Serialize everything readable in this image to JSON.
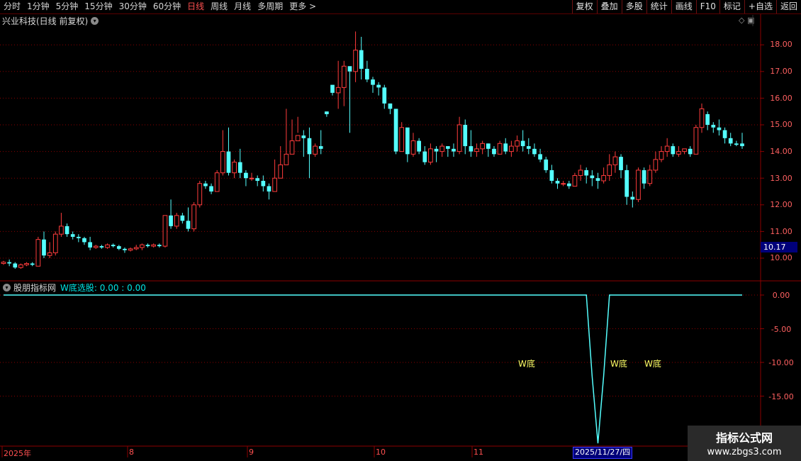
{
  "toolbar": {
    "periods": [
      "分时",
      "1分钟",
      "5分钟",
      "15分钟",
      "30分钟",
      "60分钟",
      "日线",
      "周线",
      "月线",
      "多周期",
      "更多 >"
    ],
    "active_period": "日线",
    "buttons": [
      "复权",
      "叠加",
      "多股",
      "统计",
      "画线",
      "F10",
      "标记",
      "+自选",
      "返回"
    ]
  },
  "main_chart": {
    "title": "兴业科技(日线 前复权)",
    "y_ticks": [
      "18.00",
      "17.00",
      "16.00",
      "15.00",
      "14.00",
      "13.00",
      "12.00",
      "11.00",
      "10.00"
    ],
    "current_price": "10.17",
    "colors": {
      "up": "#ff3c3c",
      "down": "#54ffff",
      "grid": "#8b0000",
      "axis": "#8b0000"
    }
  },
  "indicator": {
    "name": "股朋指标网",
    "label": "W底选股: 0.00 : 0.00",
    "y_ticks": [
      "0.00",
      "-5.00",
      "-10.00",
      "-15.00"
    ],
    "w_labels": [
      "W底",
      "W底",
      "W底"
    ],
    "line_color": "#54ffff"
  },
  "x_axis": {
    "labels": [
      "2025年",
      "8",
      "9",
      "10",
      "11"
    ],
    "cursor_date": "2025/11/27/四"
  },
  "watermark": {
    "line1": "指标公式网",
    "line2": "www.zbgs3.com"
  },
  "chart_data": {
    "type": "candlestick",
    "title": "兴业科技(日线 前复权)",
    "y_ticks": [
      10,
      11,
      12,
      13,
      14,
      15,
      16,
      17,
      18
    ],
    "candles": [
      [
        9.8,
        9.85,
        9.75,
        9.9
      ],
      [
        9.85,
        9.8,
        9.7,
        9.95
      ],
      [
        9.8,
        9.65,
        9.6,
        9.85
      ],
      [
        9.65,
        9.75,
        9.6,
        9.8
      ],
      [
        9.75,
        9.8,
        9.7,
        9.85
      ],
      [
        9.8,
        9.75,
        9.7,
        9.85
      ],
      [
        9.7,
        10.7,
        9.7,
        10.8
      ],
      [
        10.7,
        10.1,
        10.0,
        11.0
      ],
      [
        10.1,
        10.2,
        10.0,
        10.6
      ],
      [
        10.2,
        10.9,
        10.1,
        11.0
      ],
      [
        10.9,
        11.2,
        10.8,
        11.7
      ],
      [
        11.2,
        10.9,
        10.8,
        11.3
      ],
      [
        10.9,
        10.8,
        10.7,
        11.0
      ],
      [
        10.8,
        10.75,
        10.6,
        10.9
      ],
      [
        10.75,
        10.6,
        10.5,
        10.8
      ],
      [
        10.6,
        10.4,
        10.3,
        10.8
      ],
      [
        10.4,
        10.45,
        10.35,
        10.5
      ],
      [
        10.45,
        10.4,
        10.35,
        10.5
      ],
      [
        10.4,
        10.5,
        10.35,
        10.55
      ],
      [
        10.5,
        10.45,
        10.4,
        10.55
      ],
      [
        10.45,
        10.35,
        10.3,
        10.5
      ],
      [
        10.35,
        10.3,
        10.2,
        10.4
      ],
      [
        10.3,
        10.35,
        10.25,
        10.4
      ],
      [
        10.35,
        10.4,
        10.3,
        10.5
      ],
      [
        10.4,
        10.5,
        10.3,
        10.55
      ],
      [
        10.5,
        10.45,
        10.4,
        10.55
      ],
      [
        10.45,
        10.5,
        10.4,
        10.55
      ],
      [
        10.5,
        10.45,
        10.4,
        10.55
      ],
      [
        10.45,
        11.6,
        10.4,
        11.6
      ],
      [
        11.6,
        11.2,
        11.1,
        12.2
      ],
      [
        11.2,
        11.6,
        11.1,
        11.7
      ],
      [
        11.6,
        11.4,
        11.3,
        11.7
      ],
      [
        11.4,
        11.1,
        11.0,
        11.9
      ],
      [
        11.1,
        12.0,
        11.0,
        12.1
      ],
      [
        12.0,
        12.8,
        11.9,
        12.9
      ],
      [
        12.8,
        12.7,
        12.6,
        12.9
      ],
      [
        12.7,
        12.5,
        12.4,
        12.8
      ],
      [
        12.5,
        13.2,
        12.5,
        13.3
      ],
      [
        13.2,
        14.0,
        13.1,
        14.8
      ],
      [
        14.0,
        13.2,
        13.1,
        14.9
      ],
      [
        13.2,
        13.6,
        13.0,
        13.7
      ],
      [
        13.6,
        13.2,
        13.0,
        14.1
      ],
      [
        13.2,
        13.0,
        12.7,
        13.3
      ],
      [
        13.0,
        13.0,
        12.9,
        13.2
      ],
      [
        13.0,
        12.9,
        12.7,
        13.1
      ],
      [
        12.9,
        12.7,
        12.5,
        13.1
      ],
      [
        12.7,
        12.5,
        12.2,
        12.8
      ],
      [
        12.5,
        13.0,
        12.5,
        13.7
      ],
      [
        13.0,
        13.5,
        13.2,
        14.2
      ],
      [
        13.5,
        13.9,
        13.6,
        15.6
      ],
      [
        13.9,
        14.4,
        14.1,
        15.2
      ],
      [
        14.4,
        14.6,
        14.7,
        15.3
      ],
      [
        14.6,
        14.5,
        13.8,
        14.8
      ],
      [
        14.5,
        13.9,
        13.0,
        14.9
      ],
      [
        13.9,
        14.2,
        13.8,
        14.3
      ],
      [
        14.2,
        14.1,
        13.9,
        14.8
      ],
      [
        15.5,
        15.4,
        15.3,
        15.5
      ],
      [
        16.5,
        16.2,
        16.1,
        16.3
      ],
      [
        16.2,
        16.4,
        15.6,
        17.4
      ],
      [
        16.4,
        17.2,
        15.7,
        17.4
      ],
      [
        17.2,
        17.0,
        14.7,
        17.0
      ],
      [
        17.0,
        17.8,
        16.6,
        18.5
      ],
      [
        17.8,
        17.1,
        16.7,
        18.3
      ],
      [
        17.1,
        16.7,
        16.6,
        17.4
      ],
      [
        16.7,
        16.5,
        16.2,
        16.8
      ],
      [
        16.5,
        16.4,
        16.1,
        16.6
      ],
      [
        16.4,
        15.8,
        15.6,
        16.5
      ],
      [
        15.8,
        15.6,
        15.4,
        15.8
      ],
      [
        15.6,
        14.0,
        13.9,
        15.3
      ],
      [
        14.0,
        14.9,
        14.8,
        15.1
      ],
      [
        14.9,
        13.9,
        13.6,
        14.4
      ],
      [
        13.9,
        14.4,
        13.8,
        14.7
      ],
      [
        14.4,
        14.0,
        13.9,
        14.5
      ],
      [
        14.0,
        13.6,
        13.5,
        14.2
      ],
      [
        13.6,
        14.1,
        13.5,
        14.3
      ],
      [
        14.1,
        14.0,
        13.6,
        14.2
      ],
      [
        14.0,
        14.2,
        13.8,
        14.3
      ],
      [
        14.2,
        14.1,
        13.8,
        14.2
      ],
      [
        14.1,
        14.0,
        13.8,
        14.3
      ],
      [
        14.0,
        15.0,
        13.9,
        15.3
      ],
      [
        15.0,
        14.2,
        13.9,
        15.2
      ],
      [
        14.2,
        14.0,
        13.8,
        14.8
      ],
      [
        14.0,
        14.1,
        13.8,
        14.3
      ],
      [
        14.1,
        14.3,
        13.9,
        14.4
      ],
      [
        14.3,
        14.1,
        13.8,
        14.3
      ],
      [
        14.1,
        13.9,
        13.8,
        14.2
      ],
      [
        13.9,
        14.3,
        13.9,
        14.4
      ],
      [
        14.3,
        14.0,
        13.9,
        14.5
      ],
      [
        14.0,
        14.2,
        13.8,
        14.4
      ],
      [
        14.2,
        14.4,
        14.0,
        14.6
      ],
      [
        14.4,
        14.2,
        14.0,
        14.8
      ],
      [
        14.2,
        14.1,
        13.9,
        14.5
      ],
      [
        14.1,
        13.9,
        13.8,
        14.3
      ],
      [
        13.9,
        13.7,
        13.6,
        14.1
      ],
      [
        13.7,
        13.3,
        13.2,
        13.8
      ],
      [
        13.3,
        12.9,
        12.8,
        13.5
      ],
      [
        12.9,
        12.8,
        12.6,
        13.0
      ],
      [
        12.8,
        12.8,
        12.7,
        12.9
      ],
      [
        12.8,
        12.7,
        12.6,
        12.9
      ],
      [
        12.7,
        13.1,
        12.7,
        13.2
      ],
      [
        13.1,
        13.3,
        12.9,
        13.5
      ],
      [
        13.3,
        13.1,
        12.8,
        13.4
      ],
      [
        13.1,
        13.0,
        12.7,
        13.3
      ],
      [
        13.0,
        12.9,
        12.6,
        13.2
      ],
      [
        12.9,
        13.1,
        12.8,
        13.4
      ],
      [
        13.1,
        13.5,
        12.9,
        13.9
      ],
      [
        13.5,
        13.8,
        13.2,
        14.0
      ],
      [
        13.8,
        13.3,
        13.0,
        13.9
      ],
      [
        13.3,
        12.3,
        12.0,
        13.5
      ],
      [
        12.3,
        12.2,
        11.9,
        12.5
      ],
      [
        12.2,
        13.3,
        12.1,
        13.4
      ],
      [
        13.3,
        12.8,
        12.6,
        13.4
      ],
      [
        12.8,
        13.3,
        12.7,
        13.5
      ],
      [
        13.3,
        13.7,
        13.2,
        14.0
      ],
      [
        13.7,
        14.0,
        13.6,
        14.2
      ],
      [
        14.0,
        14.2,
        13.8,
        14.5
      ],
      [
        14.2,
        13.9,
        13.8,
        14.3
      ],
      [
        13.9,
        14.0,
        13.8,
        14.2
      ],
      [
        14.0,
        14.1,
        13.9,
        14.1
      ],
      [
        14.1,
        13.9,
        13.8,
        14.2
      ],
      [
        13.9,
        14.9,
        13.9,
        15.0
      ],
      [
        14.9,
        15.6,
        14.7,
        15.8
      ],
      [
        15.4,
        15.0,
        14.8,
        15.5
      ],
      [
        15.0,
        14.9,
        14.7,
        15.1
      ],
      [
        14.9,
        14.8,
        14.6,
        15.2
      ],
      [
        14.8,
        14.5,
        14.3,
        14.9
      ],
      [
        14.5,
        14.3,
        14.2,
        14.7
      ],
      [
        14.3,
        14.25,
        14.2,
        14.4
      ],
      [
        14.3,
        14.2,
        14.1,
        14.7
      ]
    ],
    "indicator_series": {
      "name": "W底选股",
      "signal_dip_index": 103,
      "dip_value": -22.0,
      "baseline": 0.0
    },
    "x_labels": [
      "2025年",
      "8",
      "9",
      "10",
      "11"
    ]
  }
}
